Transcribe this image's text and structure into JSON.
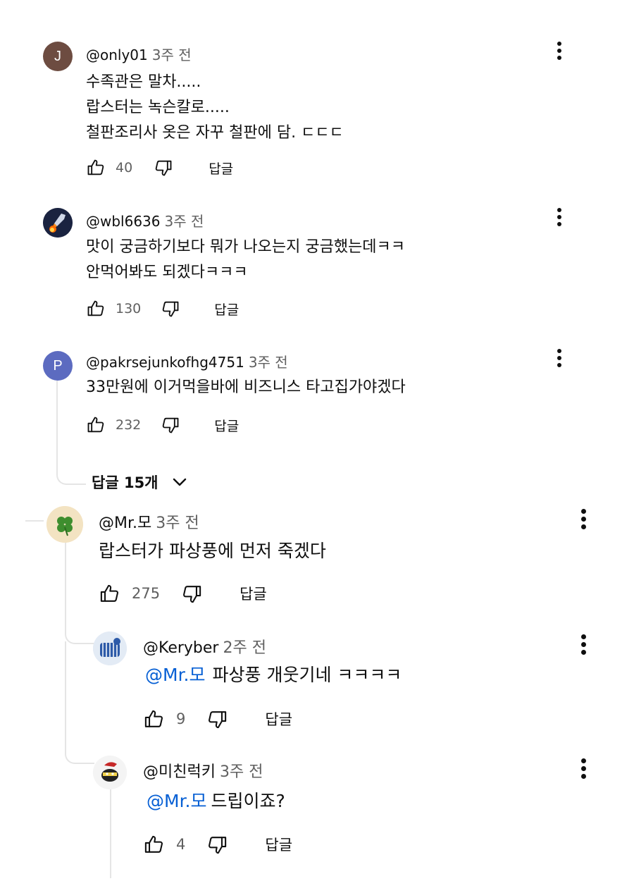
{
  "comments": [
    {
      "avatar_letter": "J",
      "avatar_color": "#6d4c41",
      "author": "@only01",
      "time": "3주 전",
      "lines": [
        "수족관은 말차.....",
        "랍스터는 녹슨칼로.....",
        "철판조리사 옷은 자꾸 철판에 담. ㄷㄷㄷ"
      ],
      "likes": "40",
      "reply_label": "답글"
    },
    {
      "avatar_icon": "rocket-avatar",
      "author": "@wbl6636",
      "time": "3주 전",
      "lines": [
        "맛이 궁금하기보다 뭐가 나오는지 궁금했는데ㅋㅋ",
        "안먹어봐도 되겠다ㅋㅋㅋ"
      ],
      "likes": "130",
      "reply_label": "답글"
    },
    {
      "avatar_letter": "P",
      "avatar_color": "#5c6bc0",
      "author": "@pakrsejunkofhg4751",
      "time": "3주 전",
      "lines": [
        "33만원에 이거먹을바에 비즈니스 타고집가야겠다"
      ],
      "likes": "232",
      "reply_label": "답글"
    }
  ],
  "replies_toggle": {
    "label": "답글 15개"
  },
  "replies": [
    {
      "avatar_icon": "clover-avatar",
      "author": "@Mr.모",
      "time": "3주 전",
      "lines": [
        "랍스터가 파상풍에 먼저 죽겠다"
      ],
      "likes": "275",
      "reply_label": "답글"
    },
    {
      "avatar_icon": "cat-avatar",
      "author": "@Keryber",
      "time": "2주 전",
      "mention": "@Mr.모",
      "text": "파상풍 개웃기네 ㅋㅋㅋㅋ",
      "likes": "9",
      "reply_label": "답글"
    },
    {
      "avatar_icon": "bird-avatar",
      "author": "@미친럭키",
      "time": "3주 전",
      "mention": "@Mr.모",
      "text": "드립이죠?",
      "likes": "4",
      "reply_label": "답글"
    }
  ]
}
